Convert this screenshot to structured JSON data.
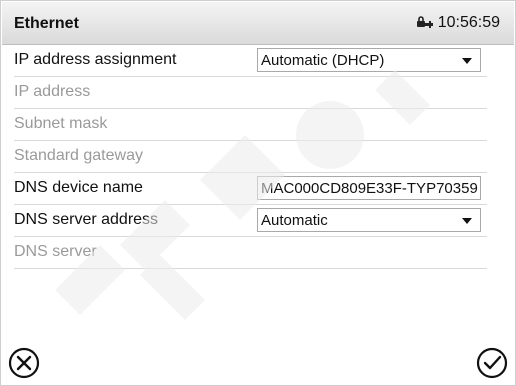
{
  "window": {
    "title": "Ethernet",
    "time": "10:56:59",
    "status_icon": "network-lock-icon"
  },
  "rows": [
    {
      "label": "IP address assignment",
      "enabled": true,
      "control": "select",
      "value": "Automatic (DHCP)"
    },
    {
      "label": "IP address",
      "enabled": false
    },
    {
      "label": "Subnet mask",
      "enabled": false
    },
    {
      "label": "Standard gateway",
      "enabled": false
    },
    {
      "label": "DNS device name",
      "enabled": true,
      "control": "text",
      "value": "MAC000CD809E33F-TYP70359"
    },
    {
      "label": "DNS server  address",
      "enabled": true,
      "control": "select",
      "value": "Automatic"
    },
    {
      "label": "DNS server",
      "enabled": false
    }
  ],
  "buttons": {
    "cancel_icon": "close-circle-icon",
    "ok_icon": "check-circle-icon"
  }
}
